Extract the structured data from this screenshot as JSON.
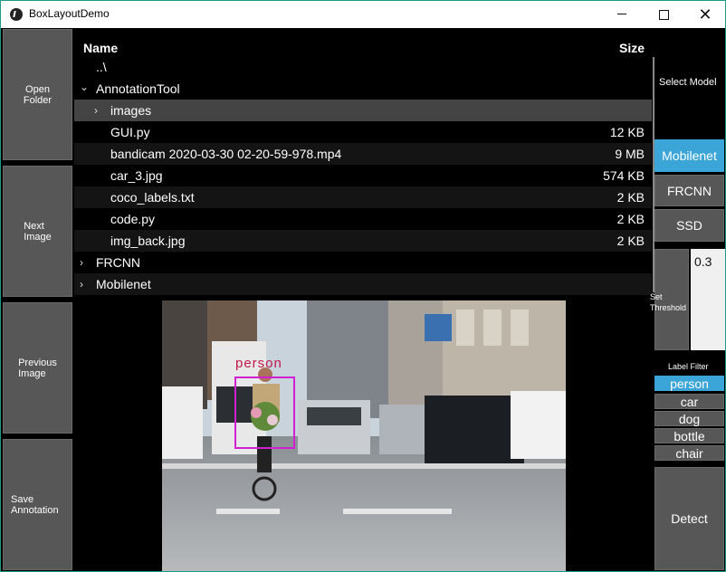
{
  "window": {
    "title": "BoxLayoutDemo",
    "min_glyph": "—",
    "close_glyph": "✕"
  },
  "left_buttons": [
    {
      "line1": "Open",
      "line2": "Folder"
    },
    {
      "line1": "Next",
      "line2": "Image"
    },
    {
      "line1": "Previous",
      "line2": "Image"
    },
    {
      "line1": "Save",
      "line2": "Annotation"
    }
  ],
  "file_view": {
    "header": {
      "name": "Name",
      "size": "Size"
    },
    "rows": [
      {
        "name": "..\\",
        "size": "",
        "chevron": ""
      },
      {
        "name": "AnnotationTool",
        "size": "",
        "chevron": "⌄"
      },
      {
        "name": "images",
        "size": "",
        "chevron": "›"
      },
      {
        "name": "GUI.py",
        "size": "12 KB",
        "chevron": ""
      },
      {
        "name": "bandicam 2020-03-30 02-20-59-978.mp4",
        "size": "9 MB",
        "chevron": ""
      },
      {
        "name": "car_3.jpg",
        "size": "574 KB",
        "chevron": ""
      },
      {
        "name": "coco_labels.txt",
        "size": "2 KB",
        "chevron": ""
      },
      {
        "name": "code.py",
        "size": "2 KB",
        "chevron": ""
      },
      {
        "name": "img_back.jpg",
        "size": "2 KB",
        "chevron": ""
      },
      {
        "name": "FRCNN",
        "size": "",
        "chevron": "›"
      },
      {
        "name": "Mobilenet",
        "size": "",
        "chevron": "›"
      }
    ]
  },
  "image": {
    "detection_label": "person"
  },
  "right_panel": {
    "select_model_label": "Select Model",
    "models": [
      "Mobilenet",
      "FRCNN",
      "SSD"
    ],
    "active_model": "Mobilenet",
    "threshold_button_line1": "Set",
    "threshold_button_line2": "Threshold",
    "threshold_value": "0.3",
    "label_filter_label": "Label Filter",
    "labels": [
      "person",
      "car",
      "dog",
      "bottle",
      "chair"
    ],
    "active_label": "person",
    "detect_label": "Detect"
  },
  "colors": {
    "accent": "#3aa5d6",
    "button": "#575757",
    "bbox": "#d020d0",
    "bbox_text": "#c01848"
  }
}
